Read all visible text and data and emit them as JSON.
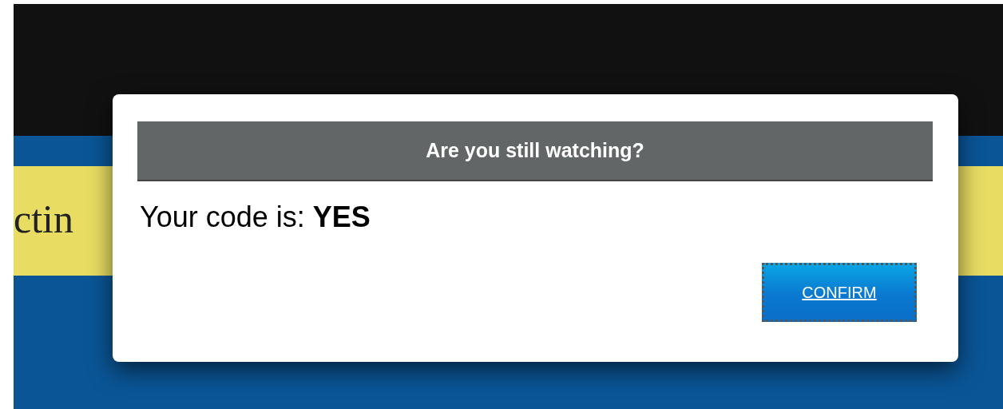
{
  "background": {
    "banner_text": "ctin"
  },
  "dialog": {
    "title": "Are you still watching?",
    "message": "Your code is: **YES**",
    "button": {
      "label": "CONFIRM",
      "focused": true
    }
  }
}
